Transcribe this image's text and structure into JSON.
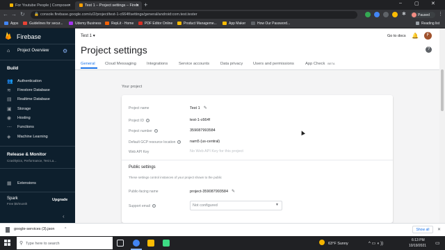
{
  "browser": {
    "tabs": [
      {
        "title": "For Youtube People | Composer",
        "active": false
      },
      {
        "title": "Test 1 – Project settings – Fireb",
        "active": true
      }
    ],
    "url": "console.firebase.google.com/u/2/project/test-1-c664f/settings/general/android:com.test.tester",
    "profile_status": "Paused",
    "bookmarks": [
      "Apps",
      "Guidelines for secur...",
      "Udemy Business",
      "RepLit - Home",
      "PDF Editor Online",
      "Product Manageme...",
      "App Maker",
      "How Our Password..."
    ],
    "reading_list": "Reading list"
  },
  "sidebar": {
    "brand": "Firebase",
    "project_overview": "Project Overview",
    "build_heading": "Build",
    "build_items": [
      {
        "label": "Authentication",
        "icon": "people-icon"
      },
      {
        "label": "Firestore Database",
        "icon": "firestore-icon"
      },
      {
        "label": "Realtime Database",
        "icon": "database-icon"
      },
      {
        "label": "Storage",
        "icon": "storage-icon"
      },
      {
        "label": "Hosting",
        "icon": "hosting-icon"
      },
      {
        "label": "Functions",
        "icon": "functions-icon"
      },
      {
        "label": "Machine Learning",
        "icon": "ml-icon"
      }
    ],
    "release_heading": "Release & Monitor",
    "release_sub": "Crashlytics, Performance, Test La...",
    "extensions": "Extensions",
    "plan_name": "Spark",
    "plan_price": "Free $0/month",
    "upgrade": "Upgrade"
  },
  "header": {
    "project_selector": "Test 1",
    "go_to_docs": "Go to docs",
    "account_initial": "F",
    "title": "Project settings",
    "tabs": [
      {
        "label": "General",
        "active": true
      },
      {
        "label": "Cloud Messaging",
        "active": false
      },
      {
        "label": "Integrations",
        "active": false
      },
      {
        "label": "Service accounts",
        "active": false
      },
      {
        "label": "Data privacy",
        "active": false
      },
      {
        "label": "Users and permissions",
        "active": false
      },
      {
        "label": "App Check",
        "active": false
      }
    ],
    "beta_badge": "BETA"
  },
  "project": {
    "section_title": "Your project",
    "fields": [
      {
        "label": "Project name",
        "value": "Test 1"
      },
      {
        "label": "Project ID",
        "value": "test-1-c664f"
      },
      {
        "label": "Project number",
        "value": "359087993584"
      },
      {
        "label": "Default GCP resource location",
        "value": "nam5 (us-central)"
      },
      {
        "label": "Web API Key",
        "value": "No Web API Key for this project"
      }
    ],
    "public_heading": "Public settings",
    "public_desc": "These settings control instances of your project shown to the public",
    "public_name_label": "Public-facing name",
    "public_name_value": "project-359087993584",
    "support_email_label": "Support email",
    "support_email_value": "Not configured"
  },
  "downloads": {
    "file": "google-services (3).json",
    "show_all": "Show all"
  },
  "taskbar": {
    "search_placeholder": "Type here to search",
    "weather": "63°F  Sunny",
    "time": "6:13 PM",
    "date": "10/19/2021"
  }
}
